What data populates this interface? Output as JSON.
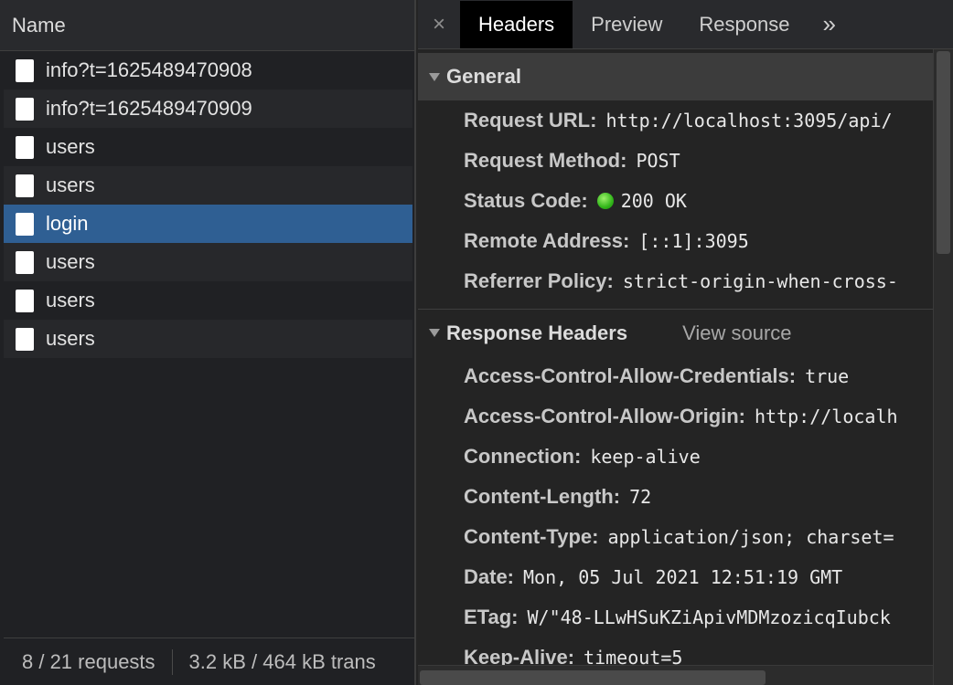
{
  "left_panel": {
    "header": "Name",
    "requests": [
      {
        "name": "info?t=1625489470908",
        "selected": false
      },
      {
        "name": "info?t=1625489470909",
        "selected": false
      },
      {
        "name": "users",
        "selected": false
      },
      {
        "name": "users",
        "selected": false
      },
      {
        "name": "login",
        "selected": true
      },
      {
        "name": "users",
        "selected": false
      },
      {
        "name": "users",
        "selected": false
      },
      {
        "name": "users",
        "selected": false
      }
    ],
    "footer": {
      "requests": "8 / 21 requests",
      "transferred": "3.2 kB / 464 kB trans"
    }
  },
  "tabs": {
    "close_glyph": "×",
    "items": [
      "Headers",
      "Preview",
      "Response"
    ],
    "active": "Headers",
    "more_glyph": "»"
  },
  "general": {
    "title": "General",
    "rows": [
      {
        "key": "Request URL:",
        "value": "http://localhost:3095/api/"
      },
      {
        "key": "Request Method:",
        "value": "POST"
      },
      {
        "key": "Status Code:",
        "value": "200 OK",
        "status_dot_color": "#32b61a"
      },
      {
        "key": "Remote Address:",
        "value": "[::1]:3095"
      },
      {
        "key": "Referrer Policy:",
        "value": "strict-origin-when-cross-"
      }
    ]
  },
  "response_headers": {
    "title": "Response Headers",
    "view_source": "View source",
    "rows": [
      {
        "key": "Access-Control-Allow-Credentials:",
        "value": "true"
      },
      {
        "key": "Access-Control-Allow-Origin:",
        "value": "http://localh"
      },
      {
        "key": "Connection:",
        "value": "keep-alive"
      },
      {
        "key": "Content-Length:",
        "value": "72"
      },
      {
        "key": "Content-Type:",
        "value": "application/json; charset="
      },
      {
        "key": "Date:",
        "value": "Mon, 05 Jul 2021 12:51:19 GMT"
      },
      {
        "key": "ETag:",
        "value": "W/\"48-LLwHSuKZiApivMDMzozicqIubck"
      },
      {
        "key": "Keep-Alive:",
        "value": "timeout=5"
      }
    ]
  }
}
